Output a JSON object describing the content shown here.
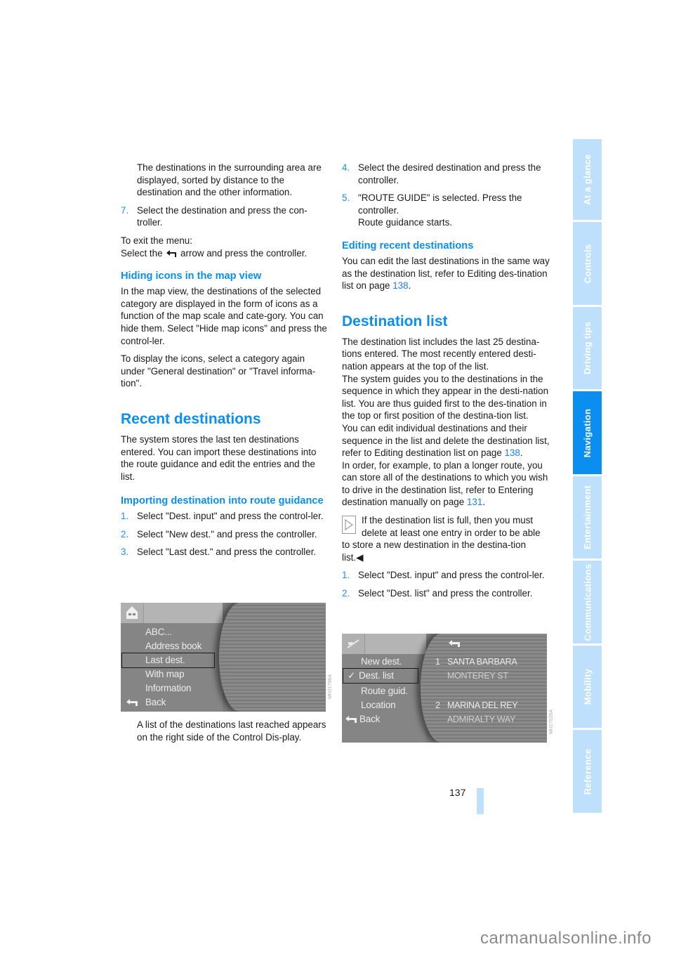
{
  "left_column": {
    "intro_continuation": "The destinations in the surrounding area are displayed, sorted by distance to the destination and the other information.",
    "step7": {
      "num": "7.",
      "text": "Select the destination and press the con-troller."
    },
    "exit_label": "To exit the menu:",
    "exit_text_before": "Select the",
    "exit_text_after": "arrow and press the controller.",
    "hiding_heading": "Hiding icons in the map view",
    "hiding_p1": "In the map view, the destinations of the selected category are displayed in the form of icons as a function of the map scale and cate-gory. You can hide them. Select \"Hide map icons\" and press the control-ler.",
    "hiding_p2": "To display the icons, select a category again under \"General destination\" or \"Travel informa-tion\".",
    "recent_heading": "Recent destinations",
    "recent_p": "The system stores the last ten destinations entered. You can import these destinations into the route guidance and edit the entries and the list.",
    "import_heading": "Importing destination into route guidance",
    "import_steps": [
      {
        "num": "1.",
        "text": "Select \"Dest. input\" and press the control-ler."
      },
      {
        "num": "2.",
        "text": "Select \"New dest.\" and press the controller."
      },
      {
        "num": "3.",
        "text": "Select \"Last dest.\" and press the controller."
      }
    ],
    "screen1": {
      "menu_items": [
        "ABC...",
        "Address book",
        "Last dest.",
        "With map",
        "Information",
        "Back"
      ],
      "selected": "Last dest.",
      "image_code": "MH21798A"
    },
    "after_screen": "A list of the destinations last reached appears on the right side of the Control Dis-play."
  },
  "right_column": {
    "steps": [
      {
        "num": "4.",
        "text": "Select the desired destination and press the controller."
      },
      {
        "num": "5.",
        "text": "\"ROUTE GUIDE\" is selected. Press the controller.",
        "extra": "Route guidance starts."
      }
    ],
    "editing_heading": "Editing recent destinations",
    "editing_text": "You can edit the last destinations in the same way as the destination list, refer to Editing des-tination list on page",
    "editing_link": "138",
    "destlist_heading": "Destination list",
    "destlist_p1": "The destination list includes the last 25 destina-tions entered. The most recently entered desti-nation appears at the top of the list.",
    "destlist_p2": "The system guides you to the destinations in the sequence in which they appear in the desti-nation list. You are thus guided first to the des-tination in the top or first position of the destina-tion list.",
    "destlist_p3": "You can edit individual destinations and their sequence in the list and delete the destination list, refer to Editing destination list on page",
    "destlist_p3_link": "138",
    "destlist_p4": "In order, for example, to plan a longer route, you can store all of the destinations to which you wish to drive in the destination list, refer to Entering destination manually on page",
    "destlist_p4_link": "131",
    "note_text": "If the destination list is full, then you must delete at least one entry in order to be able to store a new destination in the destina-tion list.",
    "note_end": "◀",
    "steps2": [
      {
        "num": "1.",
        "text": "Select \"Dest. input\" and press the control-ler."
      },
      {
        "num": "2.",
        "text": "Select \"Dest. list\" and press the controller."
      }
    ],
    "screen2": {
      "menu_items": [
        "New dest.",
        "Dest. list",
        "Route guid.",
        "Location",
        "Back"
      ],
      "selected": "Dest. list",
      "check": "✓",
      "destinations": [
        {
          "num": "1",
          "city": "SANTA BARBARA",
          "street": "MONTEREY ST"
        },
        {
          "num": "2",
          "city": "MARINA DEL REY",
          "street": "ADMIRALTY WAY"
        }
      ],
      "image_code": "MH17026A"
    }
  },
  "side_tabs": [
    {
      "label": "At a glance",
      "active": false
    },
    {
      "label": "Controls",
      "active": false
    },
    {
      "label": "Driving tips",
      "active": false
    },
    {
      "label": "Navigation",
      "active": true
    },
    {
      "label": "Entertainment",
      "active": false
    },
    {
      "label": "Communications",
      "active": false
    },
    {
      "label": "Mobility",
      "active": false
    },
    {
      "label": "Reference",
      "active": false
    }
  ],
  "page_number": "137",
  "watermark": "carmanualsonline.info",
  "colors": {
    "accent": "#0a8ef0",
    "tab_light": "#bfe0fc",
    "link": "#1e7df0"
  }
}
